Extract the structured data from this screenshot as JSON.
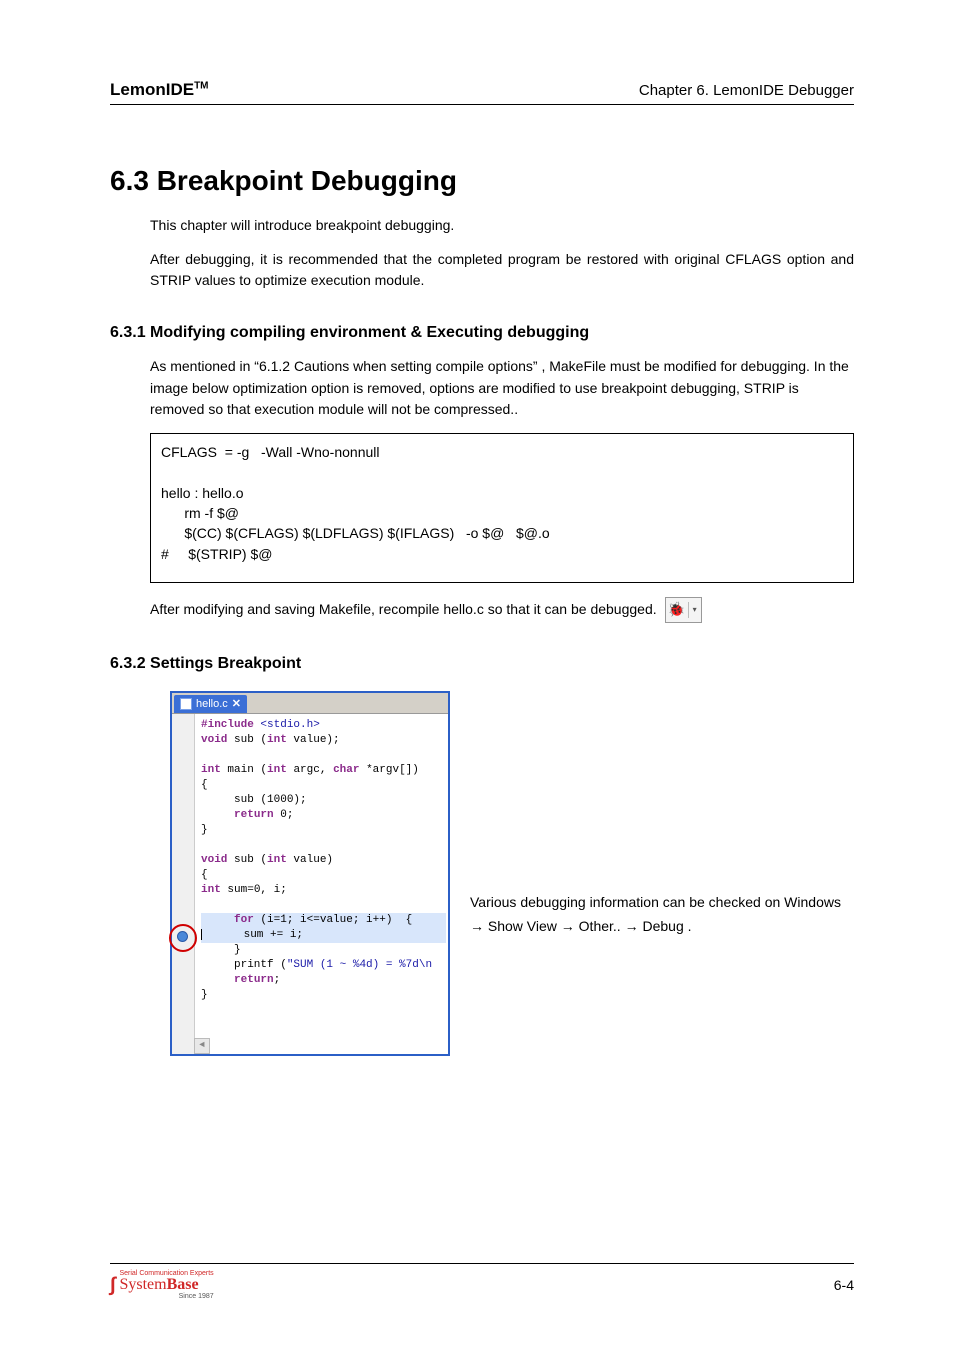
{
  "header": {
    "app_name": "LemonIDE",
    "app_tm": "TM",
    "chapter": "Chapter 6. LemonIDE Debugger"
  },
  "section": {
    "h1": "6.3 Breakpoint Debugging",
    "intro1": "This chapter will introduce breakpoint debugging.",
    "intro2": "After debugging, it is recommended that the completed program be restored with original CFLAGS option and STRIP values to optimize execution module."
  },
  "sub1": {
    "heading": "6.3.1 Modifying compiling environment & Executing debugging",
    "para": "As mentioned in   “6.1.2 Cautions when setting compile options”  , MakeFile must be modified for debugging. In the image below optimization option is removed, options are modified to use breakpoint debugging, STRIP is removed so that execution module will not be compressed..",
    "code": "CFLAGS  = -g   -Wall -Wno-nonnull\n\nhello : hello.o\n      rm -f $@\n      $(CC) $(CFLAGS) $(LDFLAGS) $(IFLAGS)   -o $@   $@.o\n#     $(STRIP) $@",
    "after_code": "After modifying and saving Makefile, recompile hello.c so that it can be debugged."
  },
  "sub2": {
    "heading": "6.3.2 Settings Breakpoint",
    "tab_label": "hello.c",
    "note_line1": "Various debugging information can be checked on   Windows",
    "note_line2": "→   Show View  →  Other..   →  Debug .",
    "source": {
      "l1a": "#include ",
      "l1b": "<stdio.h>",
      "l2a": "void",
      "l2b": " sub (",
      "l2c": "int",
      "l2d": " value);",
      "l3": "",
      "l4a": "int",
      "l4b": " main (",
      "l4c": "int",
      "l4d": " argc, ",
      "l4e": "char",
      "l4f": " *argv[])",
      "l5": "{",
      "l6": "     sub (1000);",
      "l7a": "     ",
      "l7b": "return",
      "l7c": " 0;",
      "l8": "}",
      "l9": "",
      "l10a": "void",
      "l10b": " sub (",
      "l10c": "int",
      "l10d": " value)",
      "l11": "{",
      "l12a": "int",
      "l12b": " sum=0, i;",
      "l13": "",
      "l14a": "     ",
      "l14b": "for",
      "l14c": " (i=1; i<=value; i++)  {",
      "l15": "      sum += i;",
      "l16": "     }",
      "l17a": "     printf (",
      "l17b": "\"SUM (1 ~ %4d) = %7d\\n",
      "l17c": "",
      "l18a": "     ",
      "l18b": "return",
      "l18c": ";",
      "l19": "}"
    }
  },
  "footer": {
    "logo_tag": "Serial Communication Experts",
    "logo_name_a": "System",
    "logo_name_b": "Base",
    "since": "Since 1987",
    "page": "6-4"
  },
  "icons": {
    "bug": "🐞",
    "dropdown": "▾",
    "close": "✕",
    "scroll_left": "◄"
  }
}
